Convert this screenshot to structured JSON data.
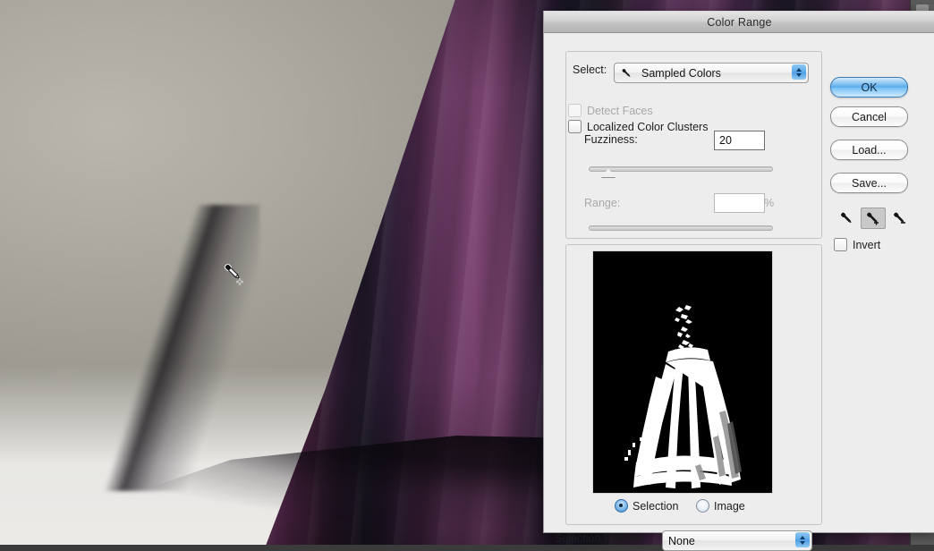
{
  "app": {
    "photo_description": "purple taffeta ball gown skirt with black tulle hem on gray studio backdrop",
    "dress_color": "#6b3a64",
    "backdrop_color": "#aeaca2",
    "cursor": "eyedropper-plus-cursor"
  },
  "panel_strip": {
    "name": "photoshop-panel-strip",
    "background": "#5a5a5a",
    "icons": [
      "panel-icon-top",
      "panel-lines-icon",
      "panel-icon-middle",
      "panel-icon-bottom"
    ]
  },
  "dialog": {
    "title": "Color Range",
    "select": {
      "label": "Select:",
      "value": "Sampled Colors",
      "icon": "eyedropper-icon"
    },
    "detect_faces": {
      "label": "Detect Faces",
      "checked": false,
      "enabled": false
    },
    "localized_color_clusters": {
      "label": "Localized Color Clusters",
      "checked": false,
      "enabled": true
    },
    "fuzziness": {
      "label": "Fuzziness:",
      "value": "20",
      "slider_percent": 10,
      "enabled": true
    },
    "range": {
      "label": "Range:",
      "value": "",
      "unit": "%",
      "slider_percent": 0,
      "enabled": false
    },
    "preview": {
      "name": "selection-mask-preview",
      "background": "#000000",
      "mask_color": "#ffffff",
      "content": "white dress silhouette selection mask on black"
    },
    "preview_mode": {
      "selection": {
        "label": "Selection",
        "selected": true
      },
      "image": {
        "label": "Image",
        "selected": false
      }
    },
    "selection_preview": {
      "label": "Selection Preview:",
      "value": "None"
    },
    "buttons": {
      "ok": "OK",
      "cancel": "Cancel",
      "load": "Load...",
      "save": "Save..."
    },
    "eyedroppers": [
      {
        "name": "eyedropper-tool",
        "selected": false
      },
      {
        "name": "eyedropper-add-tool",
        "selected": true
      },
      {
        "name": "eyedropper-subtract-tool",
        "selected": false
      }
    ],
    "invert": {
      "label": "Invert",
      "checked": false
    },
    "accent_color": "#59aaec",
    "titlebar_color": "#c2c2c2"
  }
}
